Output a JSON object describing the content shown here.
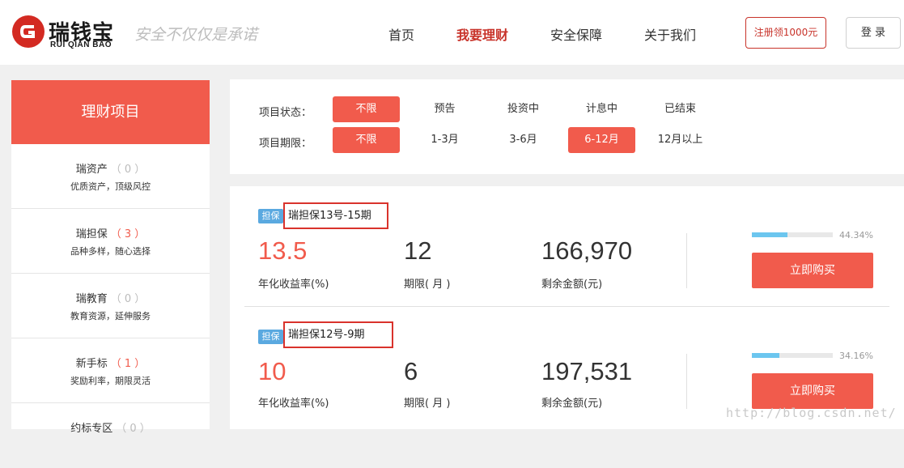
{
  "header": {
    "logo_name": "瑞钱宝",
    "logo_sub": "RUI QIAN BAO",
    "slogan": "安全不仅仅是承诺",
    "nav": [
      {
        "label": "首页"
      },
      {
        "label": "我要理财"
      },
      {
        "label": "安全保障"
      },
      {
        "label": "关于我们"
      }
    ],
    "register_label": "注册领1000元",
    "login_label": "登 录",
    "brand_color": "#f15b4c"
  },
  "sidebar": {
    "title": "理财项目",
    "items": [
      {
        "name": "瑞资产",
        "count": "（ 0 ）",
        "desc": "优质资产，顶级风控"
      },
      {
        "name": "瑞担保",
        "count": "（ 3 ）",
        "desc": "品种多样，随心选择"
      },
      {
        "name": "瑞教育",
        "count": "（ 0 ）",
        "desc": "教育资源，延伸服务"
      },
      {
        "name": "新手标",
        "count": "（ 1 ）",
        "desc": "奖励利率，期限灵活"
      },
      {
        "name": "约标专区",
        "count": "（ 0 ）",
        "desc": ""
      }
    ]
  },
  "filters": {
    "status_label": "项目状态：",
    "status_options": [
      "不限",
      "预告",
      "投资中",
      "计息中",
      "已结束"
    ],
    "term_label": "项目期限：",
    "term_options": [
      "不限",
      "1-3月",
      "3-6月",
      "6-12月",
      "12月以上"
    ]
  },
  "products": [
    {
      "tag": "担保",
      "title": "瑞担保13号-15期",
      "rate": "13.5",
      "rate_label": "年化收益率(%)",
      "term": "12",
      "term_label": "期限( 月 )",
      "remaining": "166,970",
      "remaining_label": "剩余金额(元)",
      "progress_pct": "44.34%",
      "progress": 44.34,
      "buy_label": "立即购买"
    },
    {
      "tag": "担保",
      "title": "瑞担保12号-9期",
      "rate": "10",
      "rate_label": "年化收益率(%)",
      "term": "6",
      "term_label": "期限( 月 )",
      "remaining": "197,531",
      "remaining_label": "剩余金额(元)",
      "progress_pct": "34.16%",
      "progress": 34.16,
      "buy_label": "立即购买"
    }
  ],
  "watermark": "http://blog.csdn.net/"
}
